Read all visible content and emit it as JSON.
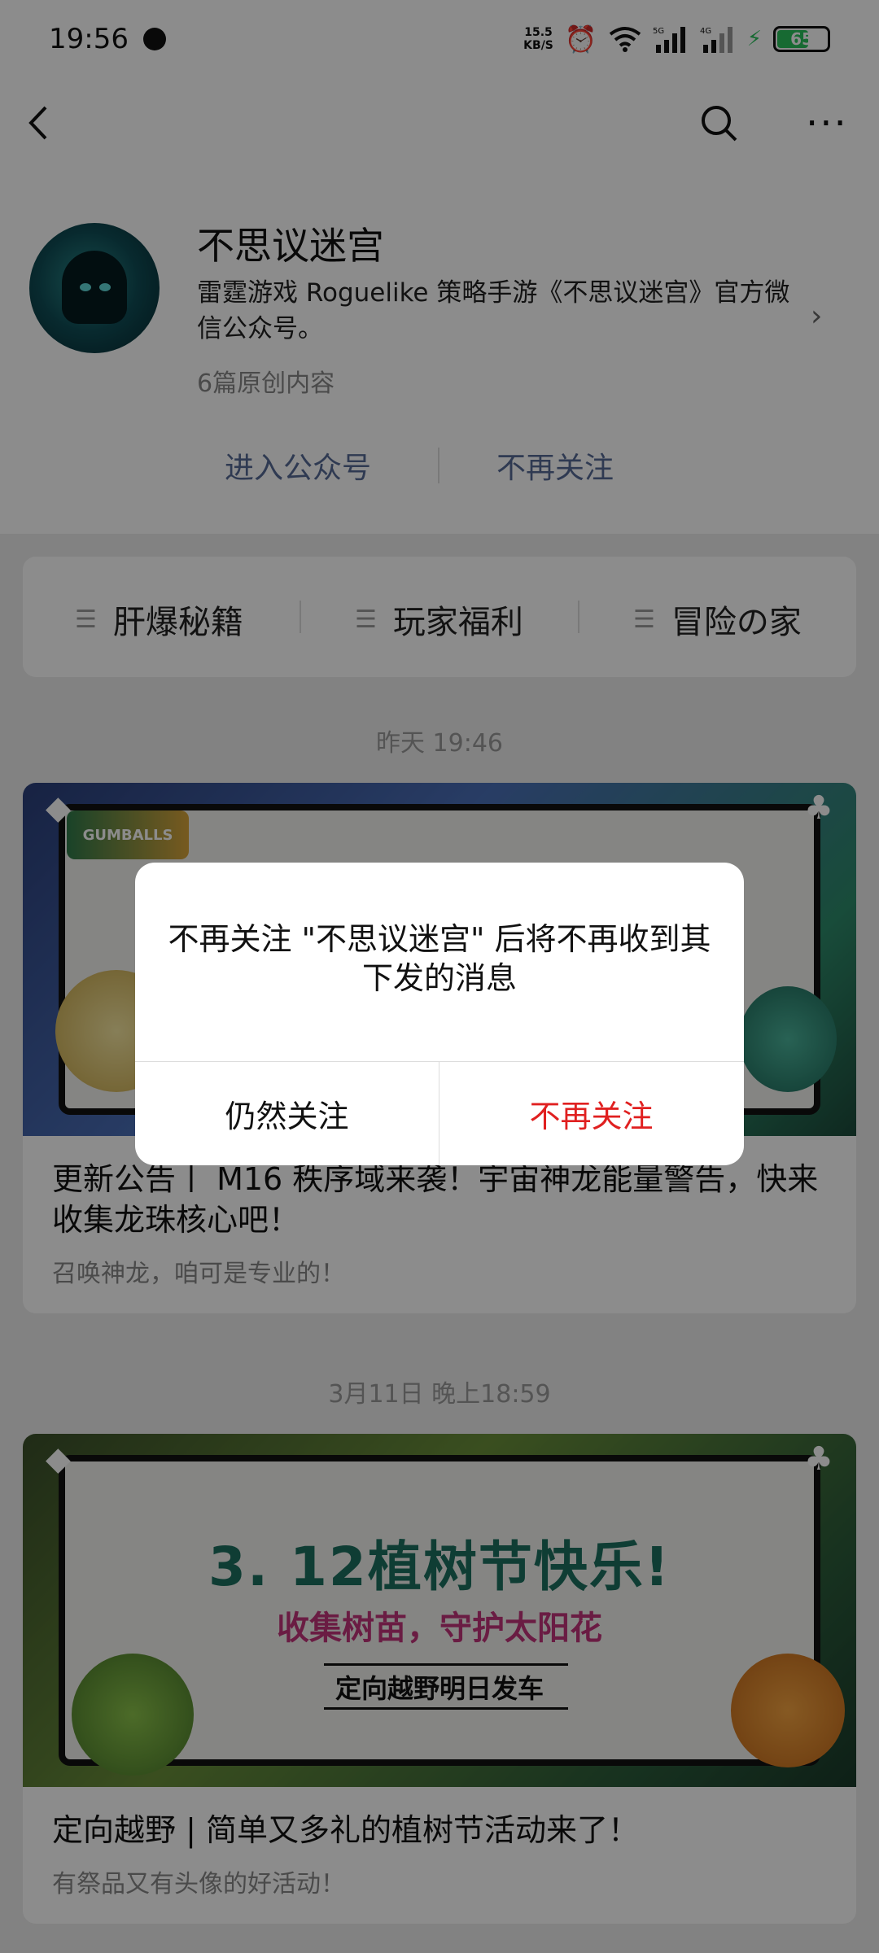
{
  "status_bar": {
    "time": "19:56",
    "net_speed_value": "15.5",
    "net_speed_unit": "KB/S",
    "signal1_label": "5G",
    "signal2_label": "4G",
    "battery": "65"
  },
  "nav": {
    "back_icon": "chevron-left-icon",
    "search_icon": "search-icon",
    "more_icon": "more-icon"
  },
  "profile": {
    "name": "不思议迷宫",
    "description": "雷霆游戏 Roguelike 策略手游《不思议迷宫》官方微信公众号。",
    "original_count": "6篇原创内容",
    "enter_label": "进入公众号",
    "unfollow_label": "不再关注"
  },
  "menu": {
    "items": [
      {
        "label": "肝爆秘籍"
      },
      {
        "label": "玩家福利"
      },
      {
        "label": "冒险の家"
      }
    ]
  },
  "feed": {
    "date1": "昨天 19:46",
    "article1": {
      "title": "更新公告丨 M16 秩序域来袭！宇宙神龙能量警告，快来收集龙珠核心吧！",
      "subtitle": "召唤神龙，咱可是专业的！"
    },
    "date2": "3月11日 晚上18:59",
    "article2": {
      "poster_line1": "3. 12植树节快乐!",
      "poster_line2": "收集树苗，守护太阳花",
      "poster_line3": "定向越野明日发车",
      "title": "定向越野 | 简单又多礼的植树节活动来了！",
      "subtitle": "有祭品又有头像的好活动！"
    }
  },
  "dialog": {
    "message": "不再关注 \"不思议迷宫\" 后将不再收到其下发的消息",
    "keep_label": "仍然关注",
    "unfollow_label": "不再关注"
  },
  "colors": {
    "link": "#576b95",
    "danger": "#e02020",
    "battery_green": "#2bc15c"
  }
}
